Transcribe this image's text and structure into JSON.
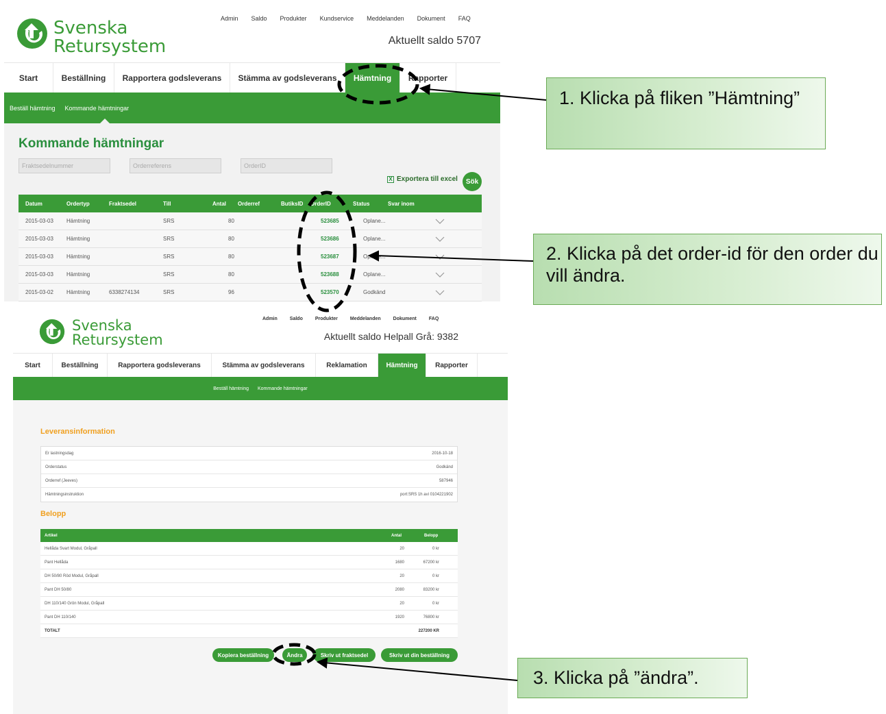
{
  "colors": {
    "brand_green": "#3a9b37",
    "heading_green": "#2a8f3e",
    "section_orange": "#f0a020",
    "callout_border": "#6aaa55"
  },
  "shot1": {
    "logo": {
      "line1": "Svenska",
      "line2": "Retursystem"
    },
    "topnav": [
      "Admin",
      "Saldo",
      "Produkter",
      "Kundservice",
      "Meddelanden",
      "Dokument",
      "FAQ"
    ],
    "saldo": "Aktuellt saldo 5707",
    "tabs": [
      "Start",
      "Beställning",
      "Rapportera godsleverans",
      "Stämma av godsleverans",
      "Hämtning",
      "Rapporter"
    ],
    "subnav": [
      "Beställ hämtning",
      "Kommande hämtningar"
    ],
    "page_title": "Kommande hämtningar",
    "filters": {
      "fraktsedel_placeholder": "Fraktsedelnummer",
      "orderref_placeholder": "Orderreferens",
      "orderid_placeholder": "OrderID"
    },
    "export_label": "Exportera till excel",
    "search_label": "Sök",
    "table": {
      "headers": [
        "Datum",
        "Ordertyp",
        "Fraktsedel",
        "Till",
        "Antal",
        "Orderref",
        "ButiksID",
        "OrderID",
        "Status",
        "Svar inom"
      ],
      "rows": [
        {
          "datum": "2015-03-03",
          "ordertyp": "Hämtning",
          "fraktsedel": "",
          "till": "SRS",
          "antal": "80",
          "orderid": "523685",
          "status": "Oplane..."
        },
        {
          "datum": "2015-03-03",
          "ordertyp": "Hämtning",
          "fraktsedel": "",
          "till": "SRS",
          "antal": "80",
          "orderid": "523686",
          "status": "Oplane..."
        },
        {
          "datum": "2015-03-03",
          "ordertyp": "Hämtning",
          "fraktsedel": "",
          "till": "SRS",
          "antal": "80",
          "orderid": "523687",
          "status": "Oplane..."
        },
        {
          "datum": "2015-03-03",
          "ordertyp": "Hämtning",
          "fraktsedel": "",
          "till": "SRS",
          "antal": "80",
          "orderid": "523688",
          "status": "Oplane..."
        },
        {
          "datum": "2015-03-02",
          "ordertyp": "Hämtning",
          "fraktsedel": "6338274134",
          "till": "SRS",
          "antal": "96",
          "orderid": "523570",
          "status": "Godkänd"
        }
      ]
    }
  },
  "shot2": {
    "logo": {
      "line1": "Svenska",
      "line2": "Retursystem"
    },
    "topnav": [
      "Admin",
      "Saldo",
      "Produkter",
      "Meddelanden",
      "Dokument",
      "FAQ"
    ],
    "saldo": "Aktuellt saldo Helpall Grå: 9382",
    "tabs": [
      "Start",
      "Beställning",
      "Rapportera godsleverans",
      "Stämma av godsleverans",
      "Reklamation",
      "Hämtning",
      "Rapporter"
    ],
    "subnav": [
      "Beställ hämtning",
      "Kommande hämtningar"
    ],
    "section_leverans": "Leveransinformation",
    "info": [
      {
        "label": "Er lastningsdag",
        "value": "2016-10-18"
      },
      {
        "label": "Orderstatus",
        "value": "Godkänd"
      },
      {
        "label": "Orderref (Jeeves)",
        "value": "587946"
      },
      {
        "label": "Hämtningsinstruktion",
        "value": "port:SRS 1h avi 0104221902"
      }
    ],
    "section_belopp": "Belopp",
    "belopp_headers": [
      "Artikel",
      "Antal",
      "Belopp"
    ],
    "belopp_rows": [
      {
        "artikel": "Hellåda Svart Modul, Gråpall",
        "antal": "20",
        "belopp": "0 kr"
      },
      {
        "artikel": "Pant Hellåda",
        "antal": "1680",
        "belopp": "67200 kr"
      },
      {
        "artikel": "DH 50/80 Röd Modul, Gråpall",
        "antal": "20",
        "belopp": "0 kr"
      },
      {
        "artikel": "Pant DH 50/80",
        "antal": "2080",
        "belopp": "83200 kr"
      },
      {
        "artikel": "DH 110/140 Grön Modul, Gråpall",
        "antal": "20",
        "belopp": "0 kr"
      },
      {
        "artikel": "Pant DH 110/140",
        "antal": "1920",
        "belopp": "76800 kr"
      }
    ],
    "total": {
      "label": "TOTALT",
      "value": "227200 KR"
    },
    "buttons": {
      "kopiera": "Kopiera beställning",
      "andra": "Ändra",
      "fraktsedel": "Skriv ut fraktsedel",
      "bestallning": "Skriv ut din beställning"
    }
  },
  "callouts": {
    "step1": "1. Klicka på fliken ”Hämtning”",
    "step2": "2. Klicka på det order-id för den order du vill ändra.",
    "step3": "3. Klicka på ”ändra”."
  }
}
